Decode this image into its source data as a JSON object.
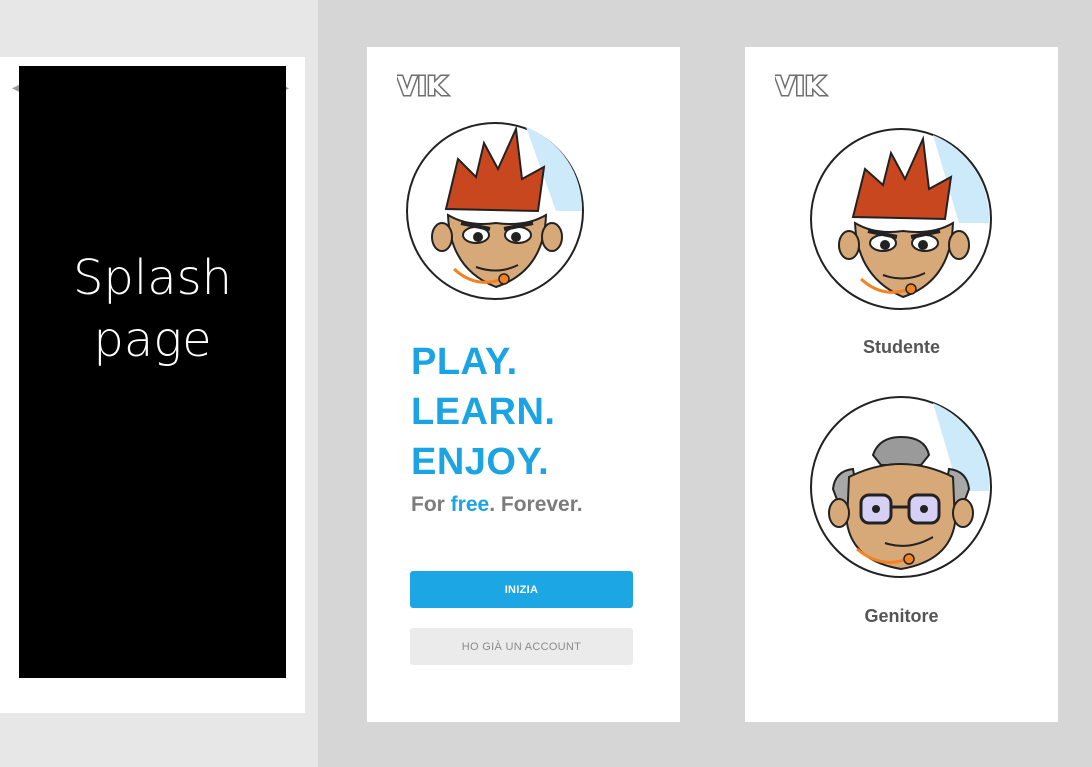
{
  "splash": {
    "heading_line1": "Splash",
    "heading_line2": "page"
  },
  "welcome": {
    "logo_text": "VIK",
    "slogan": [
      "PLAY.",
      "LEARN.",
      "ENJOY."
    ],
    "subtitle_pre": "For ",
    "subtitle_accent": "free",
    "subtitle_post": ". Forever.",
    "primary_button": "INIZIA",
    "secondary_button": "HO GIÀ UN ACCOUNT"
  },
  "roles": {
    "logo_text": "VIK",
    "items": [
      {
        "label": "Studente",
        "icon": "student-avatar-icon"
      },
      {
        "label": "Genitore",
        "icon": "parent-avatar-icon"
      }
    ]
  },
  "colors": {
    "accent": "#1ba4e3",
    "button_primary": "#1ca7e4",
    "button_secondary": "#ebebeb",
    "background": "#d6d6d6"
  }
}
